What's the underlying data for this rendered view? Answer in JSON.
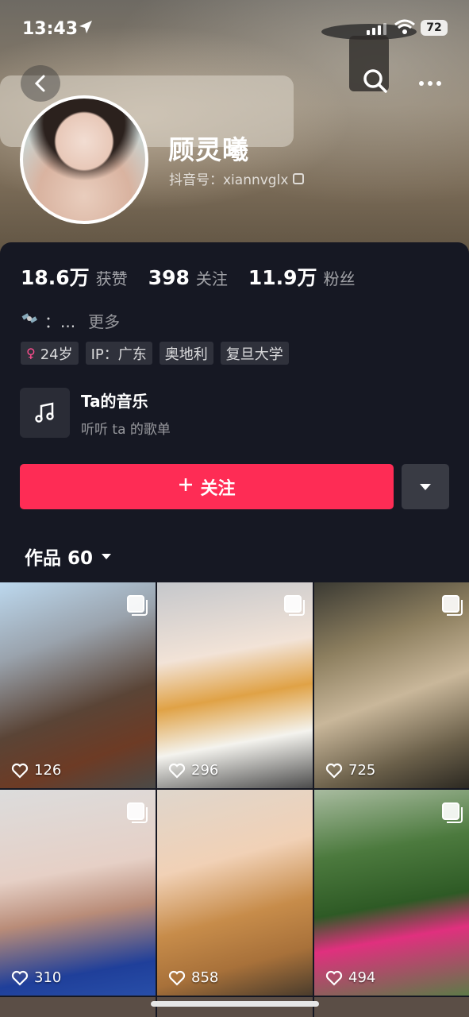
{
  "status_bar": {
    "time": "13:43",
    "battery": "72"
  },
  "profile": {
    "name": "顾灵曦",
    "douyin_id": "抖音号：xiannvglx",
    "stats": [
      {
        "num": "18.6万",
        "label": "获赞"
      },
      {
        "num": "398",
        "label": "关注"
      },
      {
        "num": "11.9万",
        "label": "粉丝"
      }
    ],
    "bio": "：...",
    "bio_more": "更多",
    "tags": {
      "age": "24岁",
      "ip": "IP：广东",
      "tag2": "奥地利",
      "tag3": "复旦大学"
    }
  },
  "music": {
    "title": "Ta的音乐",
    "subtitle": "听听 ta 的歌单"
  },
  "actions": {
    "follow_label": "关注"
  },
  "works_tab": {
    "label": "作品 60"
  },
  "posts": [
    {
      "likes": "126"
    },
    {
      "likes": "296"
    },
    {
      "likes": "725"
    },
    {
      "likes": "310"
    },
    {
      "likes": "858"
    },
    {
      "likes": "494"
    }
  ],
  "colors": {
    "accent": "#fe2c55",
    "background": "#161823"
  }
}
